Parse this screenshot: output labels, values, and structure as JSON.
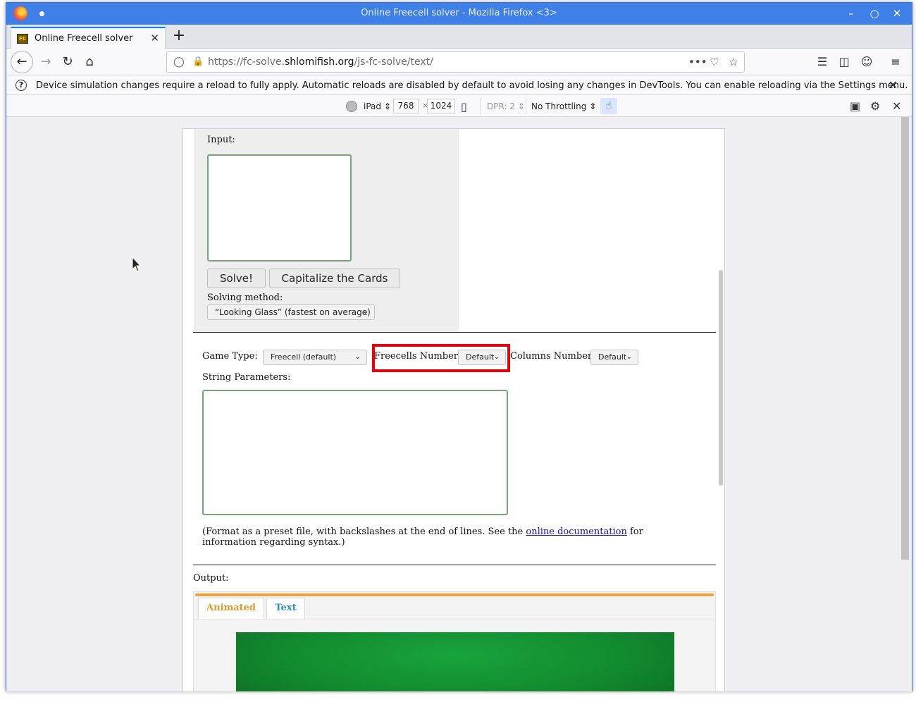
{
  "window": {
    "title": "Online Freecell solver - Mozilla Firefox <3>",
    "controls": [
      "–",
      "○",
      "✕"
    ]
  },
  "tabs": [
    {
      "label": "Online Freecell solver",
      "favicon": "FC"
    }
  ],
  "nav": {
    "url_prefix": "https://fc-solve.",
    "url_domain": "shlomifish.org",
    "url_path": "/js-fc-solve/text/",
    "page_actions": "•••"
  },
  "notification": {
    "message": "Device simulation changes require a reload to fully apply. Automatic reloads are disabled by default to avoid losing any changes in DevTools. You can enable reloading via the Settings menu."
  },
  "rdm": {
    "device": "iPad",
    "width": "768",
    "separator": "×",
    "height": "1024",
    "dpr": "DPR: 2",
    "throttling": "No Throttling"
  },
  "page": {
    "input_label": "Input:",
    "solve_button": "Solve!",
    "capitalize_button": "Capitalize the Cards",
    "solving_method_label": "Solving method:",
    "solving_method_value": "“Looking Glass” (fastest on average)",
    "game_type_label": "Game Type:",
    "game_type_value": "Freecell (default)",
    "freecells_label": "Freecells Number:",
    "freecells_value": "Default",
    "columns_label": "Columns Number:",
    "columns_value": "Default",
    "string_params_label": "String Parameters:",
    "doc_text_before": "(Format as a preset file, with backslashes at the end of lines. See the ",
    "doc_link": "online documentation",
    "doc_text_after": " for information regarding syntax.)",
    "output_label": "Output:",
    "output_tabs": [
      "Animated",
      "Text"
    ]
  },
  "colors": {
    "titlebar": "#3e7fe8",
    "highlight": "#e8000a",
    "tab_animated": "#e39a28",
    "tab_text": "#2a8fc7",
    "board": "#128a2e"
  }
}
